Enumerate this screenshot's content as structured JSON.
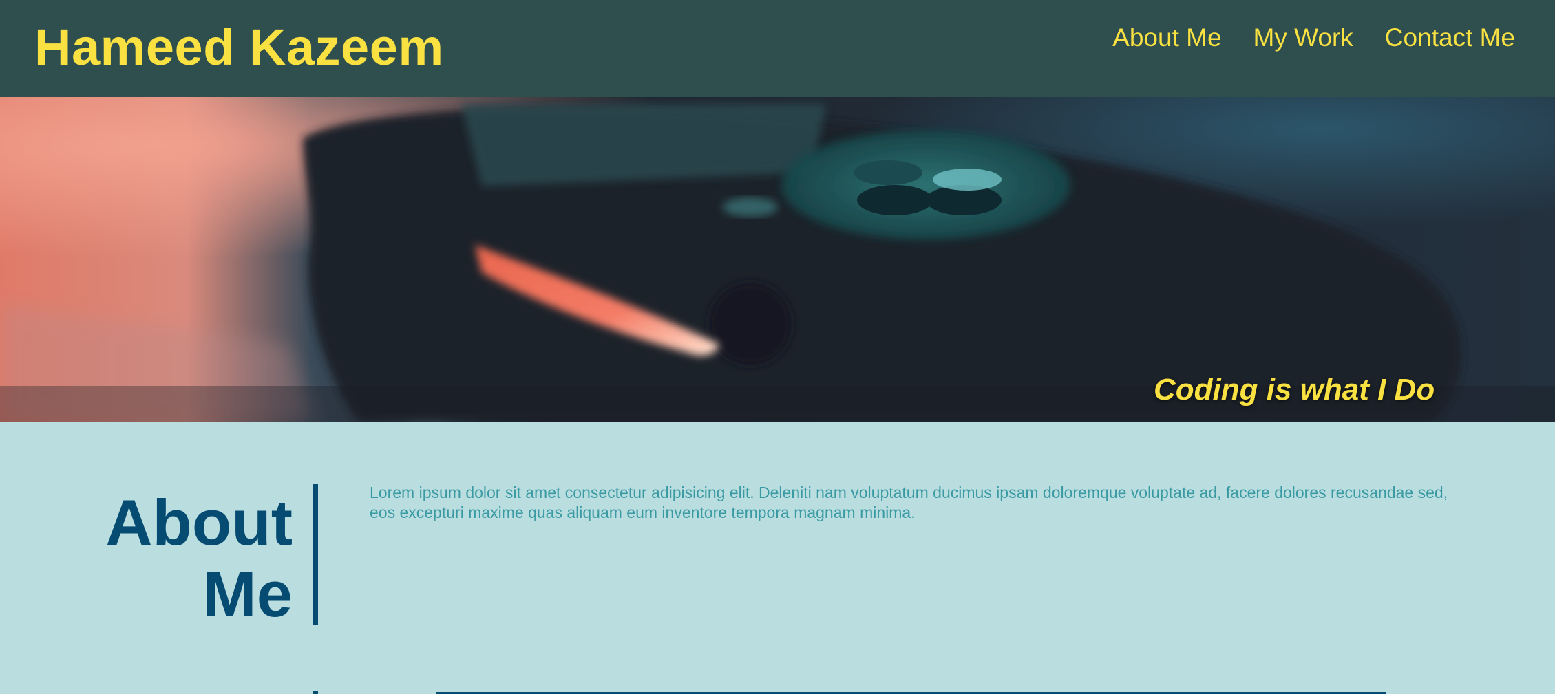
{
  "header": {
    "site_title": "Hameed Kazeem",
    "nav": [
      {
        "label": "About Me"
      },
      {
        "label": "My Work"
      },
      {
        "label": "Contact Me"
      }
    ]
  },
  "hero": {
    "tagline": "Coding is what I Do",
    "image_subject": "game-controller-photo"
  },
  "about": {
    "heading": "About Me",
    "paragraph": "Lorem ipsum dolor sit amet consectetur adipisicing elit. Deleniti nam voluptatum ducimus ipsam doloremque voluptate ad, facere dolores recusandae sed, eos excepturi maxime quas aliquam eum inventore tempora magnam minima."
  },
  "colors": {
    "header_bg": "#2f4f4f",
    "accent_yellow": "#fae142",
    "page_bg": "#badee0",
    "heading_blue": "#054b72",
    "body_text_teal": "#3a9aa3"
  }
}
